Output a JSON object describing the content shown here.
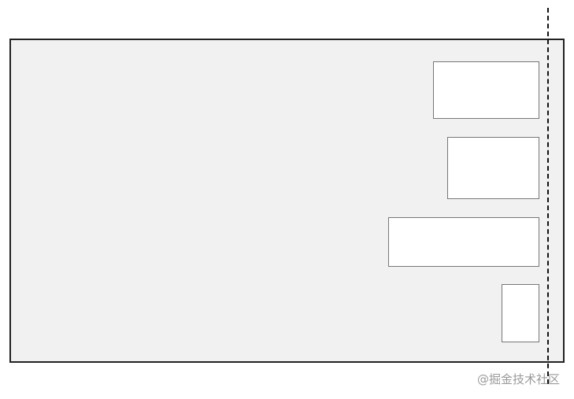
{
  "diagram": {
    "container": {
      "background": "#f1f1f1",
      "border_color": "#222222"
    },
    "boxes": [
      {
        "id": "box-1"
      },
      {
        "id": "box-2"
      },
      {
        "id": "box-3"
      },
      {
        "id": "box-4"
      }
    ],
    "guide_line": {
      "style": "dashed",
      "color": "#111111"
    }
  },
  "watermark": {
    "text": "@掘金技术社区",
    "color": "#9a9a9a"
  }
}
